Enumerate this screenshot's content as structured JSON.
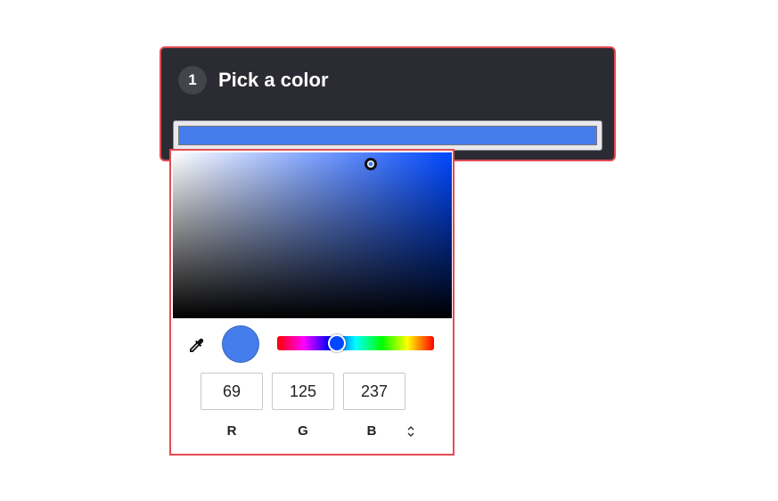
{
  "card": {
    "step_number": "1",
    "title": "Pick a color"
  },
  "color": {
    "hex": "#457ded",
    "pure_hue_hex": "#0048ff",
    "saturation": 0.71,
    "value": 0.93,
    "hue_fraction": 0.38
  },
  "picker": {
    "r": "69",
    "g": "125",
    "b": "237",
    "r_label": "R",
    "g_label": "G",
    "b_label": "B"
  },
  "icons": {
    "eyedropper": "eyedropper-icon",
    "mode_toggle": "chevron-up-down-icon"
  },
  "colors": {
    "card_background": "#2b2b33",
    "highlight_border": "#e34b52",
    "badge_background": "#44444d"
  }
}
